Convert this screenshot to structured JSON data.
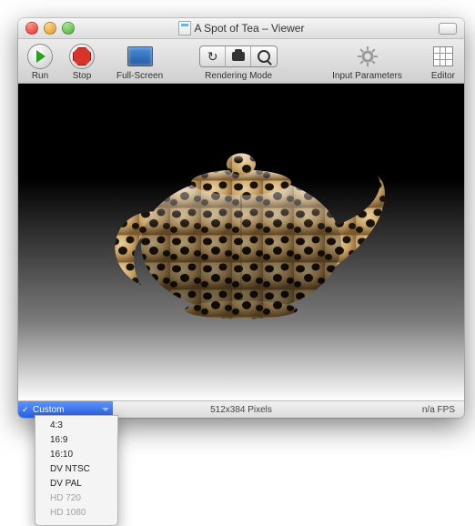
{
  "window": {
    "title": "A Spot of Tea – Viewer"
  },
  "toolbar": {
    "run_label": "Run",
    "stop_label": "Stop",
    "fullscreen_label": "Full-Screen",
    "rendering_label": "Rendering Mode",
    "input_params_label": "Input Parameters",
    "editor_label": "Editor"
  },
  "statusbar": {
    "selected_preset": "Custom",
    "resolution": "512x384 Pixels",
    "fps": "n/a FPS"
  },
  "dropdown": {
    "items": [
      {
        "label": "4:3",
        "disabled": false
      },
      {
        "label": "16:9",
        "disabled": false
      },
      {
        "label": "16:10",
        "disabled": false
      },
      {
        "label": "DV NTSC",
        "disabled": false
      },
      {
        "label": "DV PAL",
        "disabled": false
      },
      {
        "label": "HD 720",
        "disabled": true
      },
      {
        "label": "HD 1080",
        "disabled": true
      }
    ]
  }
}
